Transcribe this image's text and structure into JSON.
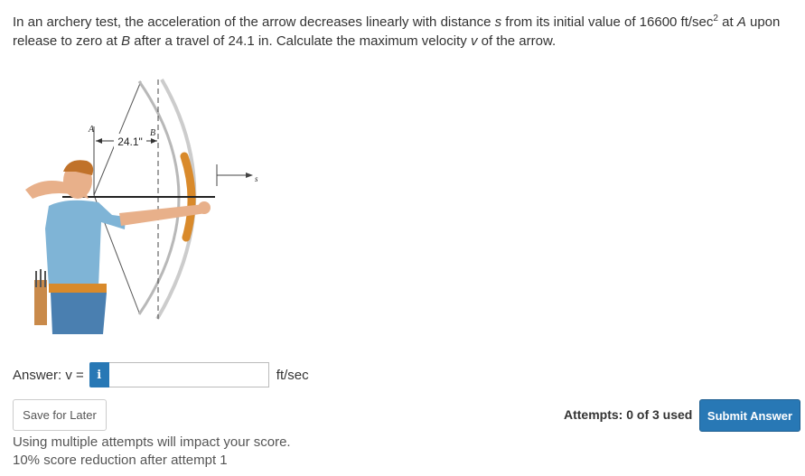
{
  "question": {
    "part1": "In an archery test, the acceleration of the arrow decreases linearly with distance ",
    "s_var": "s",
    "part2": " from its initial value of 16600 ft/sec",
    "exp": "2",
    "part3": " at ",
    "a_var": "A",
    "part4": " upon release to zero at ",
    "b_var": "B",
    "part5": " after a travel of 24.1 in. Calculate the maximum velocity ",
    "v_var": "v",
    "part6": " of the arrow."
  },
  "figure": {
    "label_a": "A",
    "label_b": "B",
    "dimension": "24.1\"",
    "label_s": "s"
  },
  "answer": {
    "label": "Answer: v =",
    "info_glyph": "i",
    "value": "",
    "unit": "ft/sec"
  },
  "buttons": {
    "save": "Save for Later",
    "submit": "Submit Answer"
  },
  "attempts": "Attempts: 0 of 3 used",
  "notes": {
    "line1": "Using multiple attempts will impact your score.",
    "line2": "10% score reduction after attempt 1"
  },
  "colors": {
    "accent": "#2878b5",
    "bow": "#d98a2b",
    "shirt": "#7fb4d6"
  }
}
